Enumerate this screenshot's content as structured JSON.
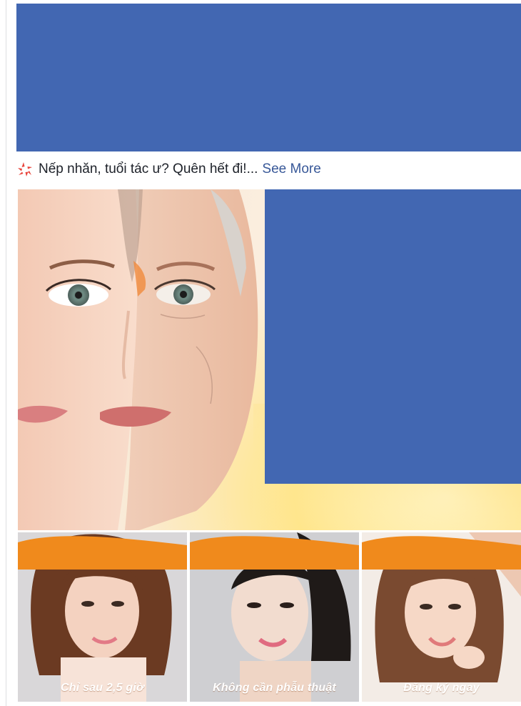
{
  "post": {
    "text": "Nếp nhăn, tuổi tác ư? Quên hết đi!...",
    "see_more": "See More",
    "emoji_icon": "anger-burst-icon"
  },
  "colors": {
    "redaction": "#4267b2",
    "link": "#385898",
    "caption_orange": "#f08a1c"
  },
  "tiles": [
    {
      "caption": "Chỉ sau 2,5 giờ"
    },
    {
      "caption": "Không cần phẫu thuật"
    },
    {
      "caption": "Đăng ký ngay"
    }
  ]
}
